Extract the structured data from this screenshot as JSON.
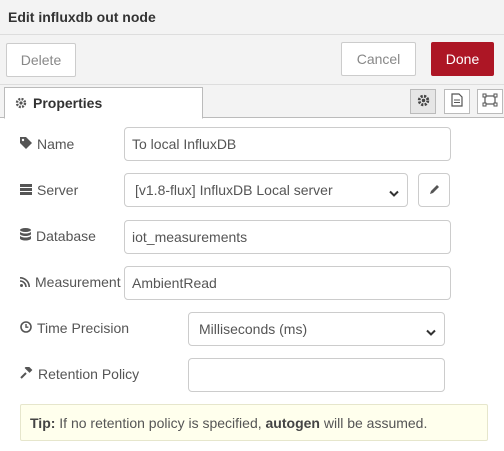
{
  "header": {
    "title": "Edit influxdb out node"
  },
  "toolbar": {
    "delete_label": "Delete",
    "cancel_label": "Cancel",
    "done_label": "Done"
  },
  "tabs": {
    "properties_label": "Properties",
    "icons": [
      "gear-icon",
      "description-icon",
      "appearance-icon"
    ]
  },
  "form": {
    "name": {
      "label": "Name",
      "value": "To local InfluxDB",
      "icon": "tag-icon"
    },
    "server": {
      "label": "Server",
      "value": "[v1.8-flux] InfluxDB Local server",
      "icon": "server-icon"
    },
    "database": {
      "label": "Database",
      "value": "iot_measurements",
      "icon": "database-icon"
    },
    "measurement": {
      "label": "Measurement",
      "value": "AmbientRead",
      "icon": "rss-icon"
    },
    "time_precision": {
      "label": "Time Precision",
      "value": "Milliseconds (ms)",
      "icon": "clock-icon"
    },
    "retention_policy": {
      "label": "Retention Policy",
      "value": "",
      "icon": "gavel-icon"
    }
  },
  "tip": {
    "prefix": "Tip:",
    "text_before": " If no retention policy is specified, ",
    "emph": "autogen",
    "text_after": " will be assumed."
  },
  "colors": {
    "done_bg": "#ad1625",
    "tip_bg": "#ffffed"
  }
}
